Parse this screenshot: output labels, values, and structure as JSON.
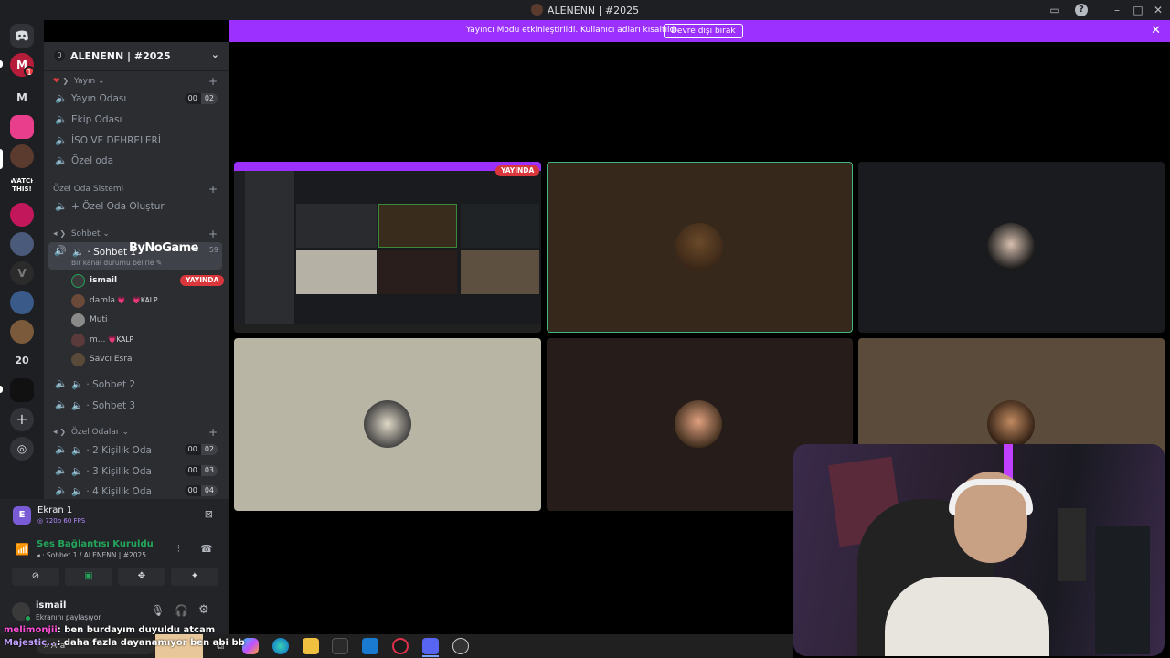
{
  "window": {
    "title": "ALENENN | #2025"
  },
  "streamer_banner": {
    "message": "Yayıncı Modu etkinleştirildi. Kullanıcı adları kısaltıldı.",
    "disable_label": "Devre dışı bırak"
  },
  "rail": {
    "unread_badge": "1",
    "m_label": "M",
    "watch_label": "WATCH\nTHIS!",
    "num_label": "20"
  },
  "guild": {
    "name": "ALENENN | #2025",
    "count": "0"
  },
  "categories": {
    "yayin": "Yayın",
    "ozel_oda_sistemi": "Özel Oda Sistemi",
    "sohbet": "Sohbet",
    "ozel_odalar": "Özel Odalar"
  },
  "channels": {
    "yayin_odasi": {
      "label": "Yayın Odası",
      "c1": "00",
      "c2": "02"
    },
    "ekip_odasi": "Ekip Odası",
    "iso": "İSO VE DEHRELERİ",
    "ozel_oda": "Özel oda",
    "create": "Özel Oda Oluştur",
    "sohbet1": {
      "label": "Sohbet 1",
      "sub": "Bir kanal durumu belirle",
      "count": "59"
    },
    "sohbet2": "Sohbet 2",
    "sohbet3": "Sohbet 3",
    "kisilik2": {
      "label": "2 Kişilik Oda",
      "c1": "00",
      "c2": "02"
    },
    "kisilik3": {
      "label": "3 Kişilik Oda",
      "c1": "00",
      "c2": "03"
    },
    "kisilik4": {
      "label": "4 Kişilik Oda",
      "c1": "00",
      "c2": "04"
    }
  },
  "overlay_brand": "ByNoGame",
  "voice_users": [
    {
      "name": "ismail",
      "badge": "YAYINDA"
    },
    {
      "name": "damla",
      "tag": "KALP"
    },
    {
      "name": "Muti"
    },
    {
      "name": "m...",
      "tag": "KALP"
    },
    {
      "name": "Savcı Esra"
    }
  ],
  "screen_share": {
    "title": "Ekran 1",
    "quality": "720p 60 FPS",
    "avatar_letter": "E"
  },
  "voice_status": {
    "title": "Ses Bağlantısı Kuruldu",
    "channel": "Sohbet 1 / ALENENN | #2025"
  },
  "user_panel": {
    "name": "ismail",
    "status": "Ekranını paylaşıyor"
  },
  "stream_tile": {
    "live_label": "YAYINDA"
  },
  "chat": [
    {
      "user": "melimonjii",
      "text": ": ben burdayım duyuldu atcam"
    },
    {
      "user": "Majestic...",
      "text": ": daha fazla dayanamıyor ben abi bb"
    }
  ],
  "taskbar": {
    "search_label": "Ara"
  },
  "colors": {
    "accent": "#9b30ff",
    "live": "#da373c",
    "connected": "#23a55a"
  }
}
